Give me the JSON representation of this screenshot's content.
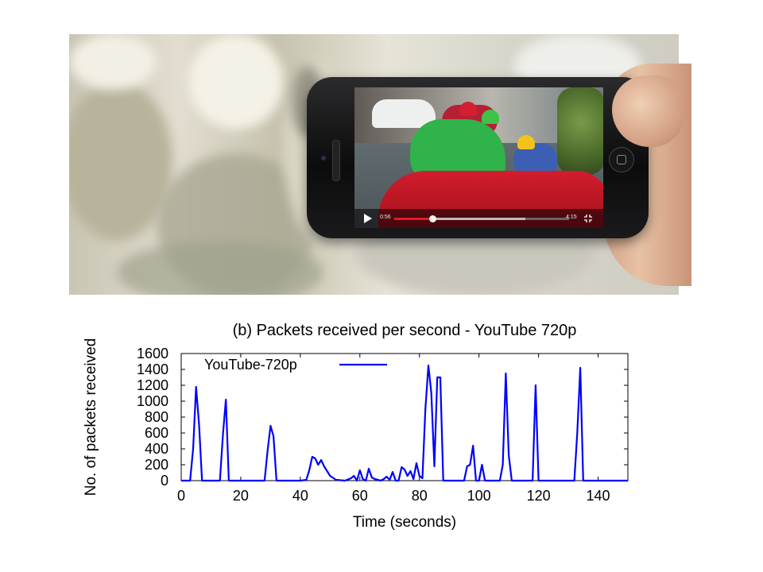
{
  "photo": {
    "video_player": {
      "elapsed_time": "0:56",
      "total_time": "4:15",
      "played_fraction": 0.22,
      "buffered_fraction": 0.75,
      "played_color": "#e01b22",
      "icons": [
        "play-icon",
        "exit-fullscreen-icon"
      ]
    }
  },
  "chart_data": {
    "type": "line",
    "title": "(b) Packets received per second - YouTube 720p",
    "xlabel": "Time (seconds)",
    "ylabel": "No. of packets received",
    "xlim": [
      0,
      150
    ],
    "ylim": [
      0,
      1600
    ],
    "xticks": [
      0,
      20,
      40,
      60,
      80,
      100,
      120,
      140
    ],
    "yticks": [
      0,
      200,
      400,
      600,
      800,
      1000,
      1200,
      1400,
      1600
    ],
    "grid": false,
    "legend_position": "top-left",
    "series": [
      {
        "name": "YouTube-720p",
        "color": "#0000ff",
        "x": [
          0,
          2,
          3,
          4,
          5,
          6,
          7,
          8,
          11,
          13,
          14,
          15,
          16,
          20,
          25,
          28,
          29,
          30,
          31,
          32,
          33,
          40,
          42,
          43,
          44,
          45,
          46,
          47,
          48,
          50,
          52,
          55,
          57,
          58,
          59,
          60,
          61,
          62,
          63,
          64,
          65,
          67,
          68,
          69,
          70,
          71,
          72,
          73,
          74,
          75,
          76,
          77,
          78,
          79,
          80,
          81,
          82,
          83,
          84,
          85,
          86,
          87,
          88,
          89,
          92,
          95,
          96,
          97,
          98,
          99,
          100,
          101,
          102,
          105,
          107,
          108,
          109,
          110,
          111,
          115,
          118,
          119,
          120,
          121,
          125,
          132,
          133,
          134,
          135,
          136,
          140,
          150
        ],
        "y": [
          0,
          0,
          0,
          400,
          1180,
          700,
          0,
          0,
          0,
          0,
          580,
          1020,
          0,
          0,
          0,
          0,
          380,
          690,
          560,
          0,
          0,
          0,
          10,
          130,
          300,
          280,
          200,
          260,
          180,
          60,
          10,
          0,
          30,
          60,
          0,
          130,
          20,
          0,
          150,
          40,
          20,
          0,
          20,
          50,
          10,
          110,
          0,
          0,
          170,
          140,
          60,
          120,
          20,
          220,
          60,
          30,
          900,
          1450,
          1100,
          180,
          1300,
          1300,
          0,
          0,
          0,
          0,
          180,
          200,
          440,
          0,
          0,
          200,
          0,
          0,
          0,
          200,
          1350,
          320,
          0,
          0,
          0,
          1200,
          0,
          0,
          0,
          0,
          600,
          1420,
          0,
          0,
          0,
          0
        ]
      }
    ]
  }
}
